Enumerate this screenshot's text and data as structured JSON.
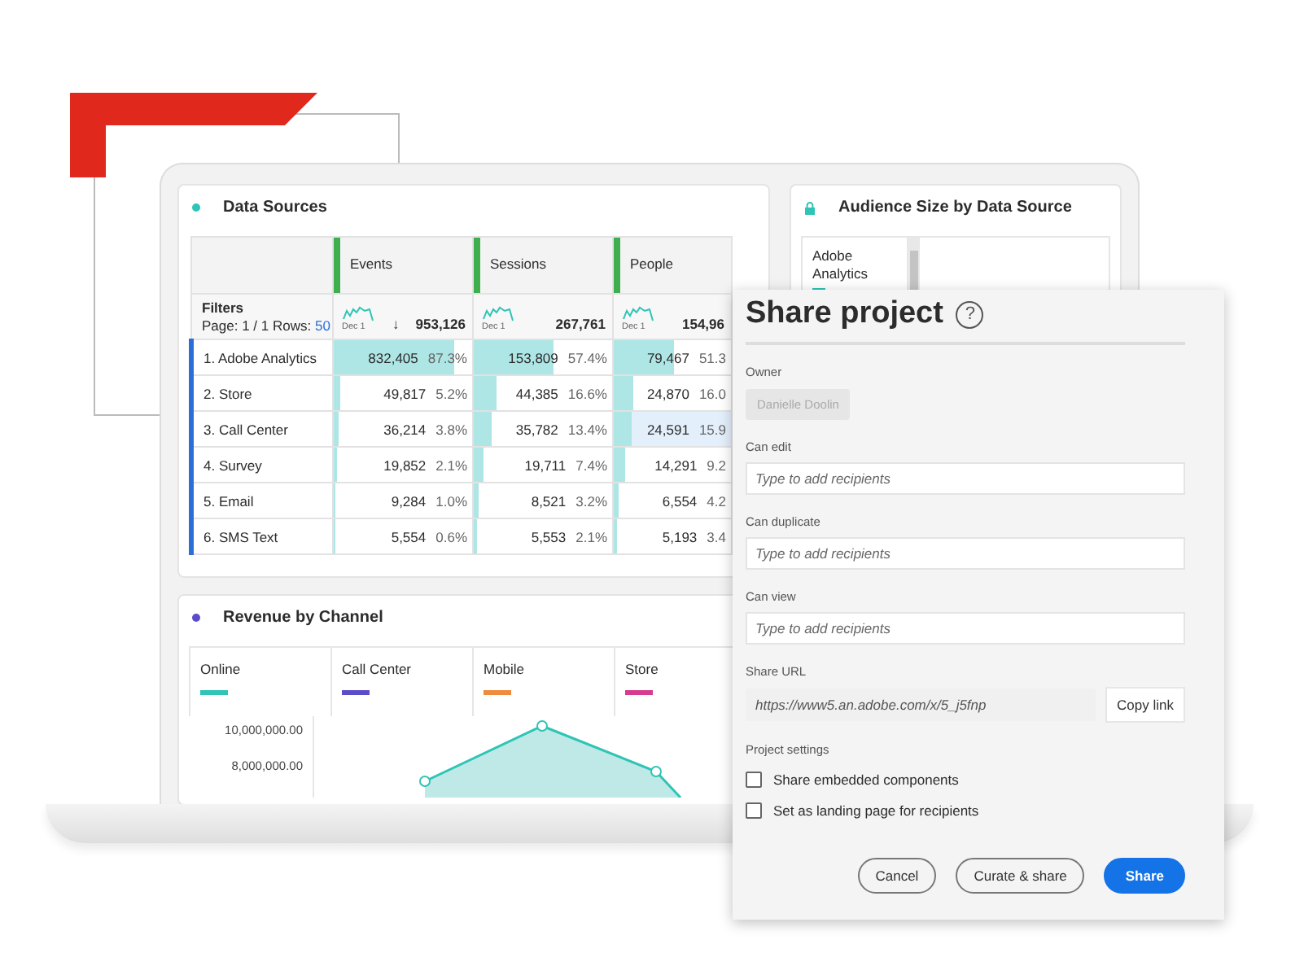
{
  "data_sources": {
    "title": "Data Sources",
    "columns": [
      "Events",
      "Sessions",
      "People"
    ],
    "filters": {
      "label": "Filters",
      "page": "Page: 1 / 1 Rows:",
      "rows_count": "50"
    },
    "totals": [
      {
        "sort_arrow": "↓",
        "value": "953,126",
        "date": "Dec 1"
      },
      {
        "value": "267,761",
        "date": "Dec 1"
      },
      {
        "value": "154,96",
        "date": "Dec 1"
      }
    ],
    "rows": [
      {
        "label": "1. Adobe Analytics",
        "cells": [
          {
            "value": "832,405",
            "percent": "87.3%",
            "level": 0.873,
            "highlighted": false
          },
          {
            "value": "153,809",
            "percent": "57.4%",
            "level": 0.574,
            "highlighted": false
          },
          {
            "value": "79,467",
            "percent": "51.3",
            "level": 0.513,
            "highlighted": false
          }
        ]
      },
      {
        "label": "2. Store",
        "cells": [
          {
            "value": "49,817",
            "percent": "5.2%",
            "level": 0.052,
            "highlighted": false
          },
          {
            "value": "44,385",
            "percent": "16.6%",
            "level": 0.166,
            "highlighted": false
          },
          {
            "value": "24,870",
            "percent": "16.0",
            "level": 0.16,
            "highlighted": false
          }
        ]
      },
      {
        "label": "3. Call Center",
        "cells": [
          {
            "value": "36,214",
            "percent": "3.8%",
            "level": 0.038,
            "highlighted": false
          },
          {
            "value": "35,782",
            "percent": "13.4%",
            "level": 0.134,
            "highlighted": false
          },
          {
            "value": "24,591",
            "percent": "15.9",
            "level": 0.159,
            "highlighted": true
          }
        ]
      },
      {
        "label": "4. Survey",
        "cells": [
          {
            "value": "19,852",
            "percent": "2.1%",
            "level": 0.021,
            "highlighted": false
          },
          {
            "value": "19,711",
            "percent": "7.4%",
            "level": 0.074,
            "highlighted": false
          },
          {
            "value": "14,291",
            "percent": "9.2",
            "level": 0.092,
            "highlighted": false
          }
        ]
      },
      {
        "label": "5. Email",
        "cells": [
          {
            "value": "9,284",
            "percent": "1.0%",
            "level": 0.01,
            "highlighted": false
          },
          {
            "value": "8,521",
            "percent": "3.2%",
            "level": 0.032,
            "highlighted": false
          },
          {
            "value": "6,554",
            "percent": "4.2",
            "level": 0.042,
            "highlighted": false
          }
        ]
      },
      {
        "label": "6. SMS Text",
        "cells": [
          {
            "value": "5,554",
            "percent": "0.6%",
            "level": 0.006,
            "highlighted": false
          },
          {
            "value": "5,553",
            "percent": "2.1%",
            "level": 0.021,
            "highlighted": false
          },
          {
            "value": "5,193",
            "percent": "3.4",
            "level": 0.034,
            "highlighted": false
          }
        ]
      }
    ]
  },
  "audience": {
    "title": "Audience Size by Data Source",
    "label": "Adobe Analytics"
  },
  "revenue": {
    "title": "Revenue by Channel",
    "legend": [
      {
        "label": "Online",
        "color": "#2ec4b6"
      },
      {
        "label": "Call Center",
        "color": "#5b4ccc"
      },
      {
        "label": "Mobile",
        "color": "#f08a3c"
      },
      {
        "label": "Store",
        "color": "#d63b8f"
      }
    ],
    "yticks": [
      "10,000,000.00",
      "8,000,000.00"
    ]
  },
  "dialog": {
    "title": "Share project",
    "help_icon": "?",
    "owner": {
      "label": "Owner",
      "value": "Danielle Doolin"
    },
    "fields": [
      {
        "label": "Can edit",
        "placeholder": "Type to add recipients"
      },
      {
        "label": "Can duplicate",
        "placeholder": "Type to add recipients"
      },
      {
        "label": "Can view",
        "placeholder": "Type to add recipients"
      }
    ],
    "share_url": {
      "label": "Share URL",
      "value": "https://www5.an.adobe.com/x/5_j5fnp",
      "button": "Copy link"
    },
    "settings": {
      "label": "Project settings",
      "options": [
        {
          "label": "Share embedded components",
          "checked": false
        },
        {
          "label": "Set as landing page for recipients",
          "checked": false
        }
      ]
    },
    "buttons": [
      {
        "label": "Cancel",
        "kind": "secondary"
      },
      {
        "label": "Curate & share",
        "kind": "secondary"
      },
      {
        "label": "Share",
        "kind": "primary"
      }
    ]
  }
}
